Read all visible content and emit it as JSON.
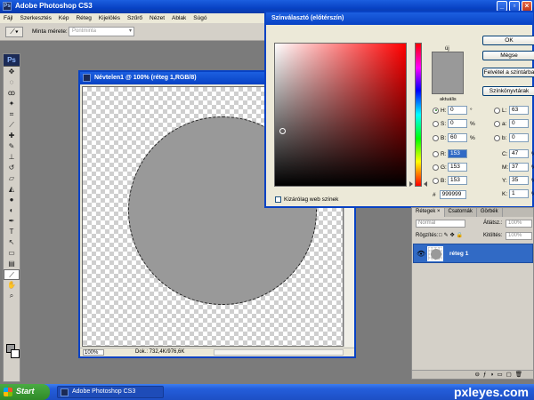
{
  "app": {
    "title": "Adobe Photoshop CS3"
  },
  "menu": [
    "Fájl",
    "Szerkesztés",
    "Kép",
    "Réteg",
    "Kijelölés",
    "Szűrő",
    "Nézet",
    "Ablak",
    "Súgó"
  ],
  "options": {
    "sample_label": "Minta mérete:",
    "sample_value": "Pontminta"
  },
  "document": {
    "title": "Névtelen1 @ 100% (réteg 1,RGB/8)",
    "zoom": "100%",
    "doc_info": "Dok.: 732,4K/976,6K",
    "fill_color": "#999999"
  },
  "picker": {
    "title": "Színválasztó (előtérszín)",
    "new_label": "új",
    "current_label": "aktuális",
    "buttons": {
      "ok": "OK",
      "cancel": "Mégse",
      "add_swatch": "Felvétel a színtárba",
      "libraries": "Színkönyvtárak"
    },
    "hsb": {
      "h_label": "H:",
      "h": "0",
      "h_unit": "°",
      "s_label": "S:",
      "s": "0",
      "s_unit": "%",
      "b_label": "B:",
      "b": "60",
      "b_unit": "%"
    },
    "rgb": {
      "r_label": "R:",
      "r": "153",
      "g_label": "G:",
      "g": "153",
      "b_label": "B:",
      "b": "153"
    },
    "lab": {
      "l_label": "L:",
      "l": "63",
      "a_label": "a:",
      "a": "0",
      "b_label": "b:",
      "b": "0"
    },
    "cmyk": {
      "c_label": "C:",
      "c": "47",
      "c_unit": "%",
      "m_label": "M:",
      "m": "37",
      "m_unit": "%",
      "y_label": "Y:",
      "y": "35",
      "y_unit": "%",
      "k_label": "K:",
      "k": "1",
      "k_unit": "%"
    },
    "hex_label": "#",
    "hex": "999999",
    "web_only_label": "Kizárólag web színek"
  },
  "layers": {
    "tabs": [
      "Rétegek ×",
      "Csatornák",
      "Görbék"
    ],
    "blend_mode": "Normál",
    "opacity_label": "Átlátsz.:",
    "opacity": "100%",
    "lock_label": "Rögzítés:",
    "fill_label": "Kitöltés:",
    "fill": "100%",
    "layer_name": "réteg 1"
  },
  "taskbar": {
    "start": "Start",
    "task": "Adobe Photoshop CS3",
    "watermark": "pxleyes.com"
  }
}
